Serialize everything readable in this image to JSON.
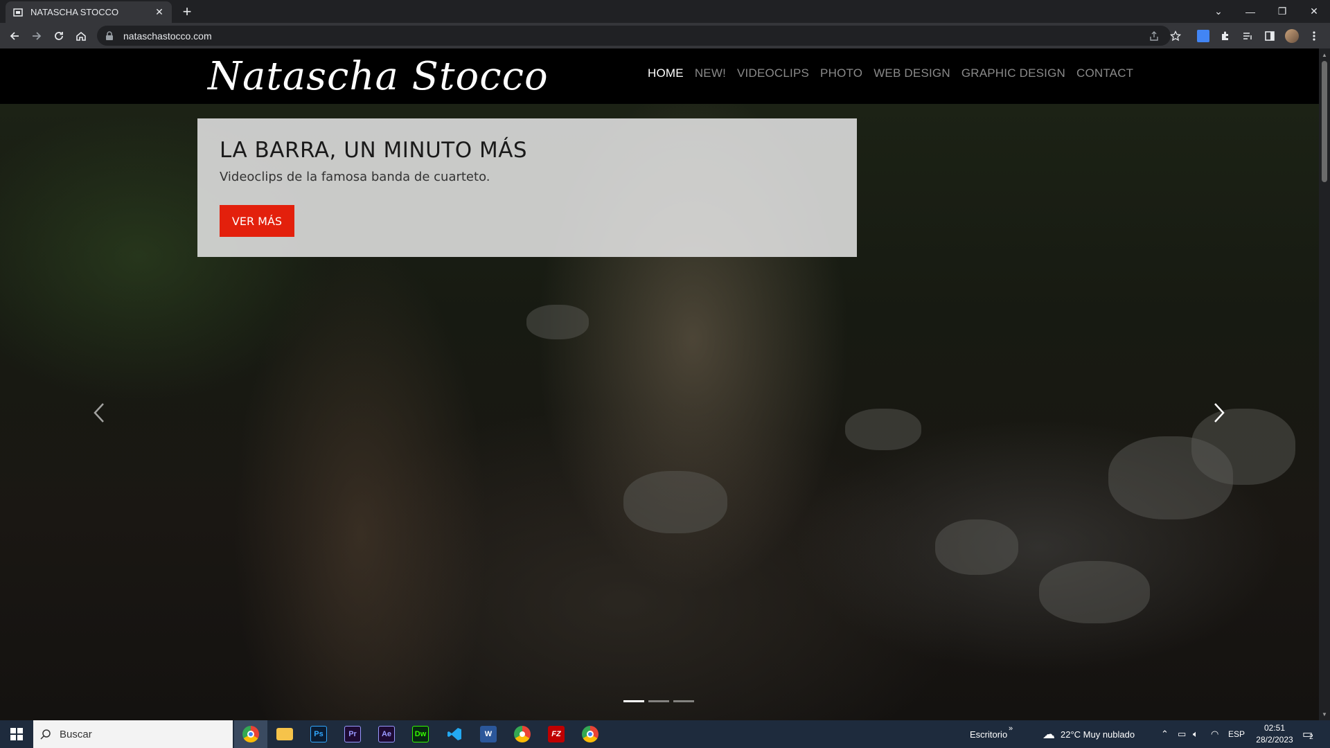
{
  "browser": {
    "tab_title": "NATASCHA STOCCO",
    "url": "nataschastocco.com"
  },
  "site": {
    "logo_text": "Natascha Stocco",
    "nav": [
      "HOME",
      "NEW!",
      "VIDEOCLIPS",
      "PHOTO",
      "WEB DESIGN",
      "GRAPHIC DESIGN",
      "CONTACT"
    ],
    "active_nav": "HOME"
  },
  "slide": {
    "title": "LA BARRA, UN MINUTO MÁS",
    "subtitle": "Videoclips de la famosa banda de cuarteto.",
    "button_label": "VER MÁS",
    "button_color": "#e3200c",
    "total_slides": 3,
    "active_slide": 1
  },
  "taskbar": {
    "search_label": "Buscar",
    "toolbar_label": "Escritorio",
    "weather": "22°C  Muy nublado",
    "language": "ESP",
    "time": "02:51",
    "date": "28/2/2023",
    "notification_count": "2",
    "apps": [
      "chrome",
      "file-explorer",
      "photoshop",
      "premiere",
      "after-effects",
      "dreamweaver",
      "vscode",
      "word",
      "chrome-alt",
      "filezilla",
      "chrome-dev"
    ]
  },
  "colors": {
    "accent_red": "#e3200c",
    "taskbar_bg": "#1e2b3d"
  }
}
